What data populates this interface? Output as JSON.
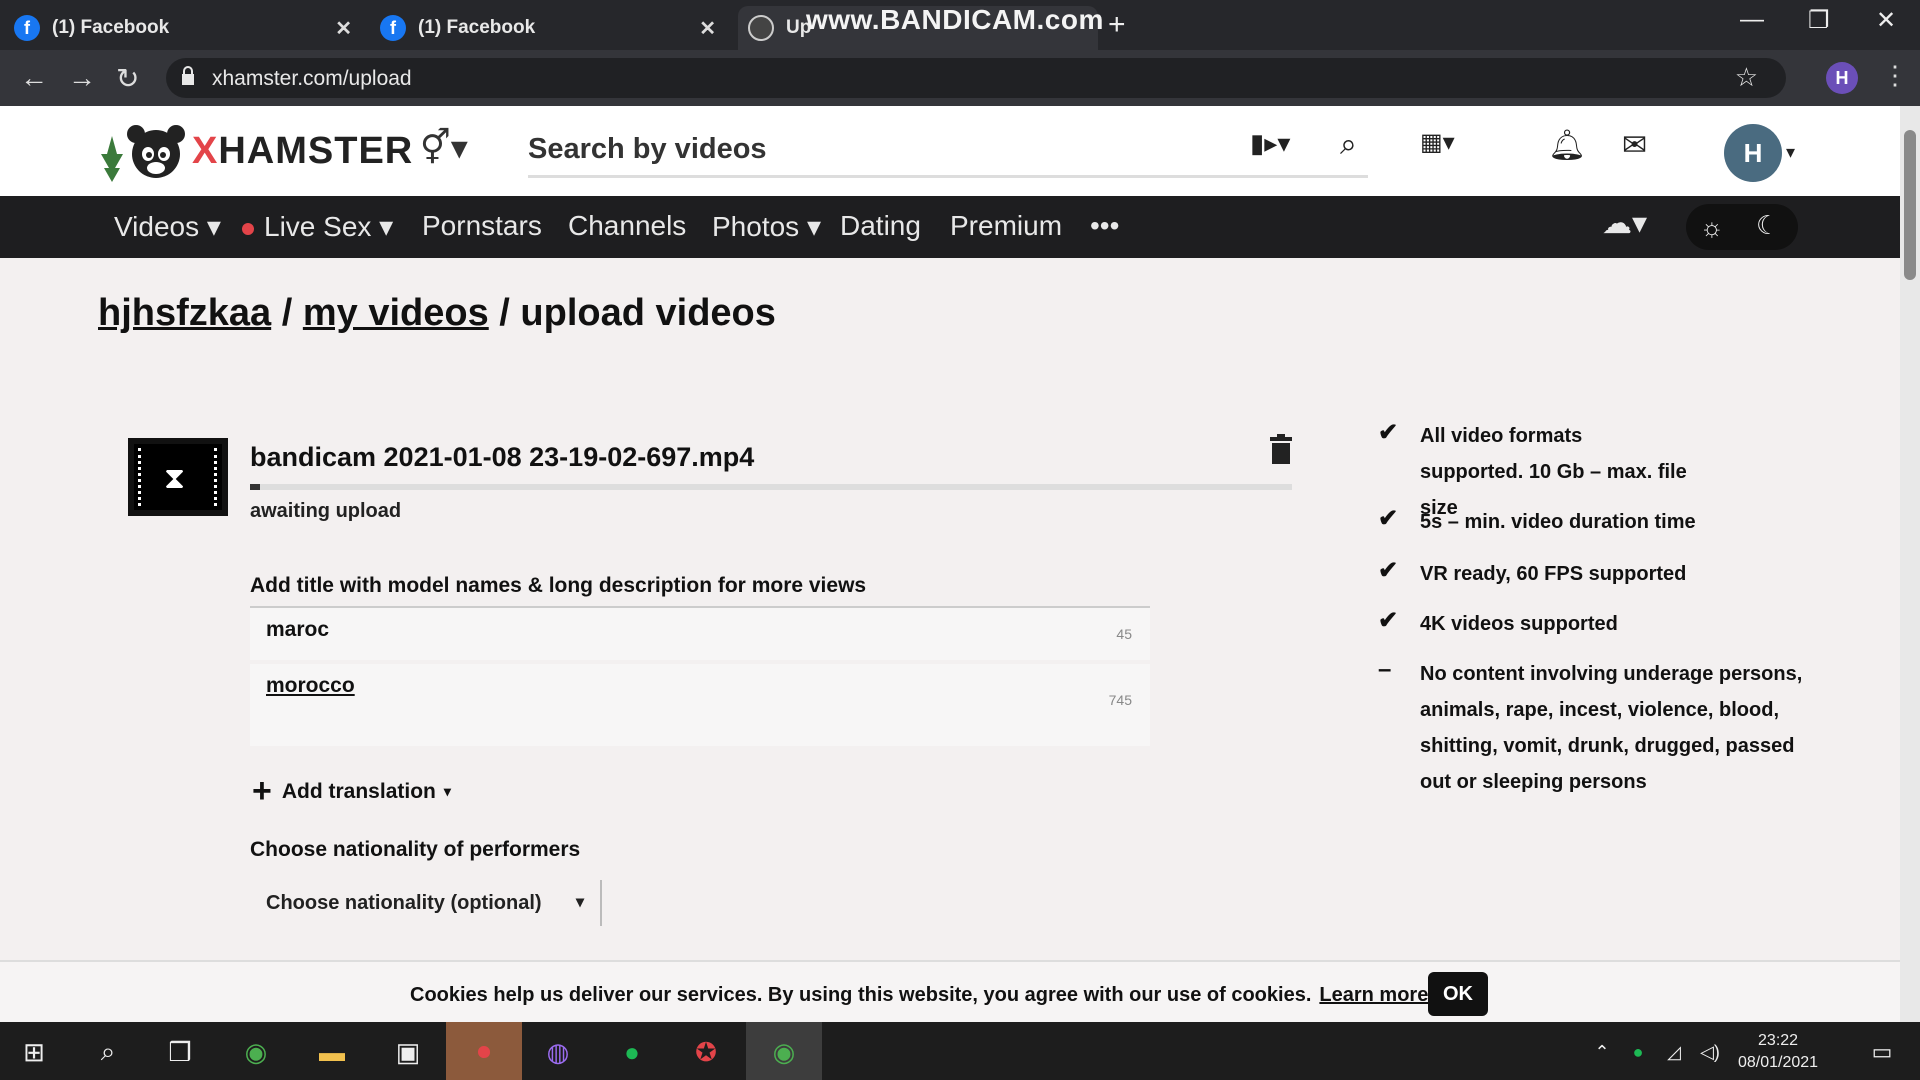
{
  "browser": {
    "tabs": [
      {
        "title": "(1) Facebook",
        "icon": "facebook-icon"
      },
      {
        "title": "(1) Facebook",
        "icon": "facebook-icon"
      },
      {
        "title": "Up",
        "icon": "xhamster-icon",
        "active": true
      }
    ],
    "watermark": "www.BANDICAM.com",
    "url": "xhamster.com/upload",
    "profile_initial": "H"
  },
  "site": {
    "logo_text": "HAMSTER",
    "logo_x": "X",
    "search_placeholder": "Search by videos",
    "avatar_initial": "H",
    "nav": [
      "Videos",
      "Live Sex",
      "Pornstars",
      "Channels",
      "Photos",
      "Dating",
      "Premium",
      "•••"
    ]
  },
  "breadcrumb": {
    "user": "hjhsfzkaa",
    "sep": "/",
    "my_videos": "my videos",
    "current": "upload videos"
  },
  "upload": {
    "filename": "bandicam 2021-01-08 23-19-02-697.mp4",
    "status": "awaiting upload",
    "progress_fraction": 0.01,
    "title_label": "Add title with model names & long description for more views",
    "title_value": "maroc",
    "title_counter": "45",
    "description_value": "morocco",
    "description_counter": "745",
    "add_translation": "Add translation",
    "nationality_label": "Choose nationality of performers",
    "nationality_placeholder": "Choose nationality (optional)"
  },
  "requirements": [
    {
      "mark": "✔",
      "text": "All video formats supported. 10 Gb – max. file size"
    },
    {
      "mark": "✔",
      "text": "5s – min. video duration time"
    },
    {
      "mark": "✔",
      "text": "VR ready, 60 FPS supported"
    },
    {
      "mark": "✔",
      "text": "4K videos supported"
    },
    {
      "mark": "–",
      "text": "No content involving underage persons, animals, rape, incest, violence, blood, shitting, vomit, drunk, drugged, passed out or sleeping persons"
    }
  ],
  "cookie": {
    "message": "Cookies help us deliver our services. By using this website, you agree with our use of cookies.",
    "link": "Learn more",
    "ok": "OK"
  },
  "taskbar": {
    "time": "23:22",
    "date": "08/01/2021"
  }
}
